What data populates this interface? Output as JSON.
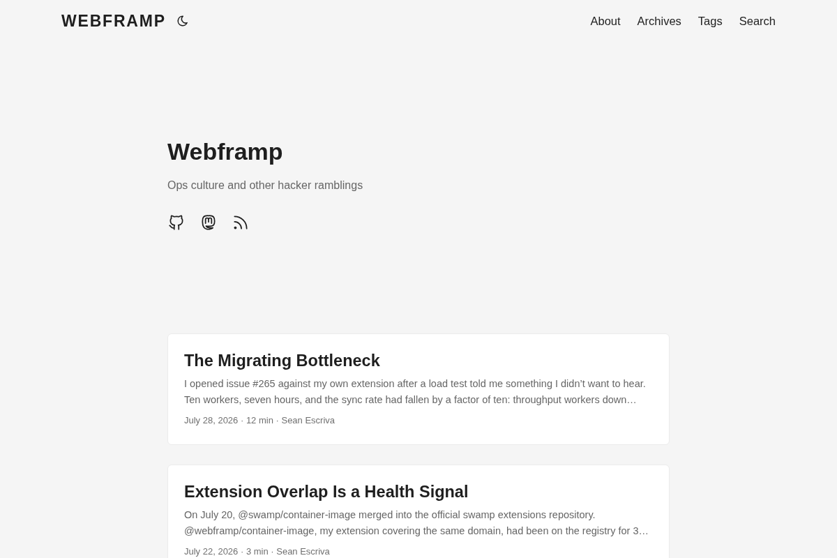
{
  "header": {
    "logo": "WEBFRAMP",
    "nav": [
      {
        "label": "About"
      },
      {
        "label": "Archives"
      },
      {
        "label": "Tags"
      },
      {
        "label": "Search"
      }
    ]
  },
  "hero": {
    "title": "Webframp",
    "tagline": "Ops culture and other hacker ramblings"
  },
  "posts": [
    {
      "title": "The Migrating Bottleneck",
      "excerpt": "I opened issue #265 against my own extension after a load test told me something I didn’t want to hear. Ten workers, seven hours, and the sync rate had fallen by a factor of ten: throughput workers down…",
      "meta": "July 28, 2026 · 12 min · Sean Escriva"
    },
    {
      "title": "Extension Overlap Is a Health Signal",
      "excerpt": "On July 20, @swamp/container-image merged into the official swamp extensions repository. @webframp/container-image, my extension covering the same domain, had been on the registry for 3…",
      "meta": "July 22, 2026 · 3 min · Sean Escriva"
    }
  ]
}
